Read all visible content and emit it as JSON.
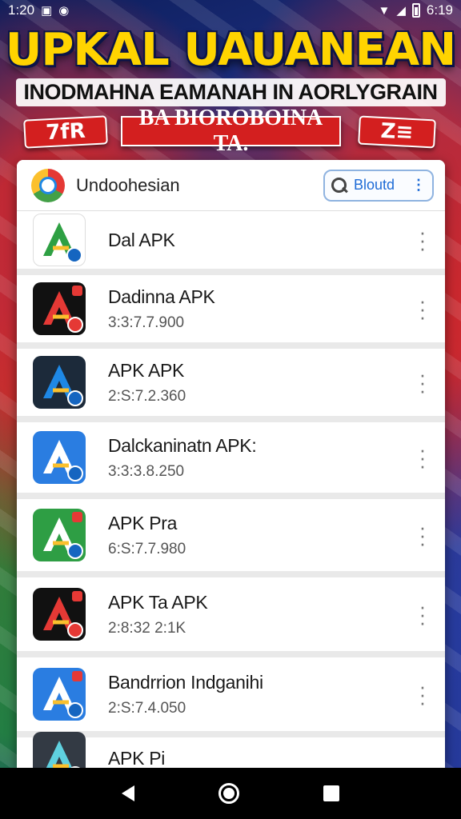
{
  "status_bar": {
    "time": "1:20",
    "right_text": "6:19",
    "icons": [
      "image-icon",
      "notification-icon",
      "wifi-icon",
      "signal-icon",
      "battery-icon"
    ]
  },
  "banner": {
    "headline": "UPKAL UAUANEAN",
    "subline": "INODMAHNA EAMANAH IN AORLYGRAIN",
    "badge_left": "7fR",
    "center_label": "BA BIOROBOINA TA.",
    "badge_right": "Z≡"
  },
  "header": {
    "title": "Undoohesian",
    "search_label": "Bloutd",
    "search_more": "⋮"
  },
  "apps": [
    {
      "name": "Dal APK",
      "version": "",
      "icon": "apk-icon-white",
      "colors": {
        "bg": "#ffffff",
        "a": "#2ea043"
      }
    },
    {
      "name": "Dadinna APK",
      "version": "3:3:7.7.900",
      "icon": "apk-icon-black-red",
      "colors": {
        "bg": "#111111",
        "a": "#e53935"
      }
    },
    {
      "name": "APK APK",
      "version": "2:S:7.2.360",
      "icon": "apk-icon-dark-multicolor",
      "colors": {
        "bg": "#1c2a3a",
        "a": "#1e88e5"
      }
    },
    {
      "name": "Dalckaninatn APK:",
      "version": "3:3:3.8.250",
      "icon": "apk-icon-blue",
      "colors": {
        "bg": "#2a7de1",
        "a": "#ffffff"
      }
    },
    {
      "name": "APK Pra",
      "version": "6:S:7.7.980",
      "icon": "apk-icon-green",
      "colors": {
        "bg": "#2e9e44",
        "a": "#ffffff"
      }
    },
    {
      "name": "APK Ta APK",
      "version": "2:8:32 2:1K",
      "icon": "apk-icon-black-red-arrow",
      "colors": {
        "bg": "#111111",
        "a": "#e53935"
      }
    },
    {
      "name": "Bandrrion Indganihi",
      "version": "2:S:7.4.050",
      "icon": "apk-icon-blue-badge",
      "colors": {
        "bg": "#2a7de1",
        "a": "#ffffff"
      }
    },
    {
      "name": "APK Pi",
      "version": "",
      "icon": "apk-icon-partial",
      "colors": {
        "bg": "#333a44",
        "a": "#5fd1e0"
      }
    }
  ],
  "nav": {
    "icons": [
      "back-icon",
      "home-icon",
      "recents-icon"
    ]
  }
}
